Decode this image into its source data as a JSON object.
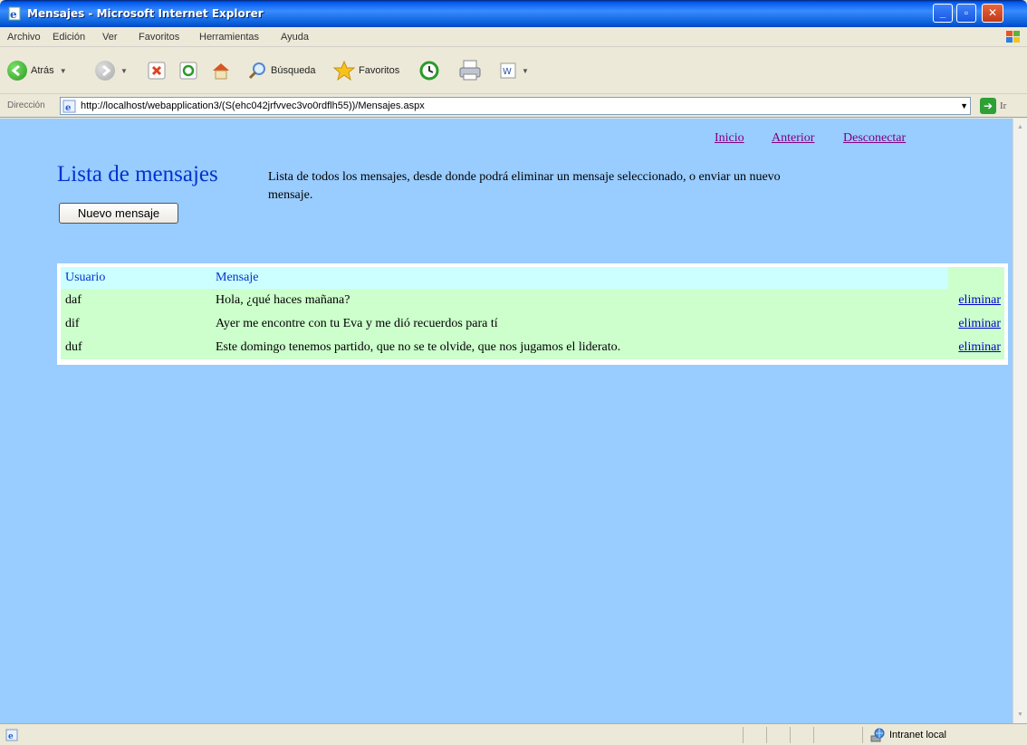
{
  "window": {
    "title": "Mensajes - Microsoft Internet Explorer"
  },
  "menu": [
    "Archivo",
    "Edición",
    "Ver",
    "Favoritos",
    "Herramientas",
    "Ayuda"
  ],
  "toolbar": {
    "back_label": "Atrás",
    "search_label": "Búsqueda",
    "favorites_label": "Favoritos"
  },
  "address": {
    "label": "Dirección",
    "url": "http://localhost/webapplication3/(S(ehc042jrfvvec3vo0rdflh55))/Mensajes.aspx",
    "go_label": "Ir"
  },
  "nav": {
    "inicio": "Inicio",
    "anterior": "Anterior",
    "desconectar": "Desconectar"
  },
  "page": {
    "title": "Lista de mensajes",
    "description": "Lista de todos los mensajes, desde donde podrá eliminar un mensaje seleccionado, o enviar un nuevo mensaje.",
    "new_button": "Nuevo mensaje"
  },
  "table": {
    "headers": [
      "Usuario",
      "Mensaje"
    ],
    "action_label": "eliminar",
    "rows": [
      {
        "usuario": "daf",
        "mensaje": "Hola, ¿qué haces mañana?"
      },
      {
        "usuario": "dif",
        "mensaje": "Ayer me encontre con tu Eva y me dió recuerdos para tí"
      },
      {
        "usuario": "duf",
        "mensaje": "Este domingo tenemos partido, que no se te olvide, que nos jugamos el liderato."
      }
    ]
  },
  "status": {
    "zone": "Intranet local"
  }
}
